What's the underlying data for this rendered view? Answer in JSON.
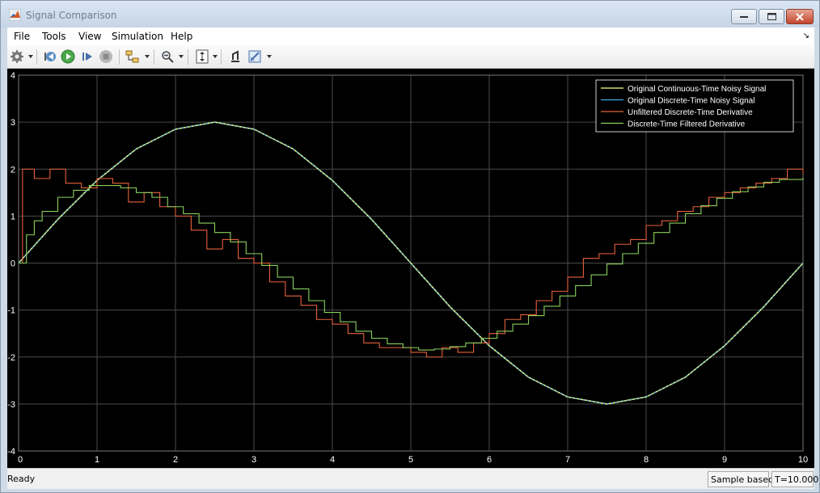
{
  "window": {
    "title": "Signal Comparison"
  },
  "menu": {
    "items": [
      "File",
      "Tools",
      "View",
      "Simulation",
      "Help"
    ]
  },
  "toolbar": {
    "buttons": [
      "gear-icon",
      "step-back-icon",
      "run-icon",
      "step-forward-icon",
      "stop-icon",
      "signal-selector-icon",
      "zoom-icon",
      "fit-axes-icon",
      "highlight-icon",
      "style-icon"
    ]
  },
  "status": {
    "text": "Ready",
    "mode": "Sample based",
    "time": "T=10.000"
  },
  "colors": {
    "background": "#000000",
    "grid": "#4a4a4a",
    "continuous": "#ffff7f",
    "discrete": "#45aeea",
    "unfiltered": "#e8603a",
    "filtered": "#8ad05c"
  },
  "chart_data": {
    "type": "line",
    "title": "",
    "xlabel": "",
    "ylabel": "",
    "xlim": [
      0,
      10
    ],
    "ylim": [
      -4,
      4
    ],
    "xticks": [
      "0",
      "1",
      "2",
      "3",
      "4",
      "5",
      "6",
      "7",
      "8",
      "9",
      "10"
    ],
    "yticks": [
      "4",
      "3",
      "2",
      "1",
      "0",
      "-1",
      "-2",
      "-3",
      "-4"
    ],
    "grid": true,
    "legend_position": "top-right",
    "series": [
      {
        "name": "Original Continuous-Time Noisy Signal",
        "color": "#ffff7f",
        "x": [
          0,
          0.5,
          1,
          1.5,
          2,
          2.5,
          3,
          3.5,
          4,
          4.5,
          5,
          5.5,
          6,
          6.5,
          7,
          7.5,
          8,
          8.5,
          9,
          9.5,
          10
        ],
        "values": [
          0,
          0.93,
          1.76,
          2.43,
          2.85,
          3.0,
          2.85,
          2.43,
          1.76,
          0.93,
          0,
          -0.93,
          -1.76,
          -2.43,
          -2.85,
          -3.0,
          -2.85,
          -2.43,
          -1.76,
          -0.93,
          0
        ]
      },
      {
        "name": "Original Discrete-Time Noisy Signal",
        "color": "#45aeea",
        "x": [
          0,
          0.5,
          1,
          1.5,
          2,
          2.5,
          3,
          3.5,
          4,
          4.5,
          5,
          5.5,
          6,
          6.5,
          7,
          7.5,
          8,
          8.5,
          9,
          9.5,
          10
        ],
        "values": [
          0,
          0.93,
          1.76,
          2.43,
          2.85,
          3.0,
          2.85,
          2.43,
          1.76,
          0.93,
          0,
          -0.93,
          -1.76,
          -2.43,
          -2.85,
          -3.0,
          -2.85,
          -2.43,
          -1.76,
          -0.93,
          0
        ]
      },
      {
        "name": "Unfiltered Discrete-Time Derivative",
        "color": "#e8603a",
        "x": [
          0,
          0.05,
          0.2,
          0.4,
          0.6,
          0.8,
          1.0,
          1.2,
          1.4,
          1.6,
          1.8,
          2.0,
          2.2,
          2.4,
          2.6,
          2.8,
          3.0,
          3.2,
          3.4,
          3.6,
          3.8,
          4.0,
          4.2,
          4.4,
          4.6,
          4.8,
          5.0,
          5.2,
          5.4,
          5.6,
          5.8,
          6.0,
          6.2,
          6.4,
          6.6,
          6.8,
          7.0,
          7.2,
          7.4,
          7.6,
          7.8,
          8.0,
          8.2,
          8.4,
          8.6,
          8.8,
          9.0,
          9.2,
          9.4,
          9.6,
          9.8,
          10.0
        ],
        "values": [
          0,
          2.0,
          1.8,
          2.0,
          1.7,
          1.6,
          1.8,
          1.7,
          1.3,
          1.5,
          1.2,
          1.0,
          0.7,
          0.3,
          0.5,
          0.1,
          0.0,
          -0.4,
          -0.7,
          -0.9,
          -1.2,
          -1.3,
          -1.5,
          -1.7,
          -1.8,
          -1.8,
          -1.9,
          -2.0,
          -1.8,
          -1.9,
          -1.7,
          -1.5,
          -1.2,
          -1.1,
          -0.8,
          -0.6,
          -0.3,
          0.1,
          0.2,
          0.4,
          0.5,
          0.8,
          0.9,
          1.1,
          1.2,
          1.4,
          1.5,
          1.6,
          1.7,
          1.8,
          2.0,
          1.9
        ]
      },
      {
        "name": "Discrete-Time Filtered Derivative",
        "color": "#8ad05c",
        "x": [
          0,
          0.1,
          0.2,
          0.3,
          0.5,
          0.7,
          0.9,
          1.1,
          1.3,
          1.5,
          1.7,
          1.9,
          2.1,
          2.3,
          2.5,
          2.7,
          2.9,
          3.1,
          3.3,
          3.5,
          3.7,
          3.9,
          4.1,
          4.3,
          4.5,
          4.7,
          4.9,
          5.1,
          5.3,
          5.5,
          5.7,
          5.9,
          6.1,
          6.3,
          6.5,
          6.7,
          6.9,
          7.1,
          7.3,
          7.5,
          7.7,
          7.9,
          8.1,
          8.3,
          8.5,
          8.7,
          8.9,
          9.1,
          9.3,
          9.5,
          9.7,
          10.0
        ],
        "values": [
          0,
          0.6,
          0.9,
          1.1,
          1.4,
          1.55,
          1.65,
          1.65,
          1.6,
          1.5,
          1.4,
          1.2,
          1.05,
          0.85,
          0.65,
          0.45,
          0.2,
          -0.05,
          -0.3,
          -0.55,
          -0.8,
          -1.05,
          -1.25,
          -1.45,
          -1.6,
          -1.72,
          -1.8,
          -1.85,
          -1.83,
          -1.78,
          -1.7,
          -1.6,
          -1.45,
          -1.3,
          -1.12,
          -0.92,
          -0.7,
          -0.48,
          -0.25,
          -0.02,
          0.2,
          0.42,
          0.65,
          0.85,
          1.05,
          1.22,
          1.38,
          1.52,
          1.62,
          1.72,
          1.78,
          1.82
        ]
      }
    ]
  }
}
